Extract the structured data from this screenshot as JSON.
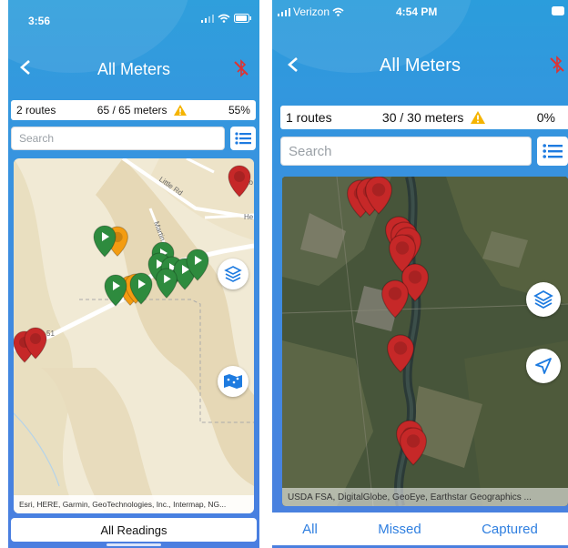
{
  "left": {
    "status": {
      "time": "3:56"
    },
    "nav": {
      "title": "All Meters"
    },
    "summary": {
      "routes": "2 routes",
      "meters": "65 / 65 meters",
      "percent": "55%"
    },
    "search": {
      "placeholder": "Search"
    },
    "map": {
      "road_labels": [
        "Little Rd",
        "Martin St",
        "Lo",
        "He",
        "51"
      ],
      "attribution": "Esri, HERE, Garmin, GeoTechnologies, Inc., Intermap, NG..."
    },
    "footer": {
      "label": "All Readings"
    }
  },
  "right": {
    "status": {
      "carrier": "Verizon",
      "time": "4:54 PM"
    },
    "nav": {
      "title": "All Meters"
    },
    "summary": {
      "routes": "1 routes",
      "meters": "30 / 30 meters",
      "percent": "0%"
    },
    "search": {
      "placeholder": "Search"
    },
    "map": {
      "attribution": "USDA FSA, DigitalGlobe, GeoEye, Earthstar Geographics ..."
    },
    "tabs": [
      "All",
      "Missed",
      "Captured"
    ]
  },
  "colors": {
    "header_blue": "#3a8fe0",
    "marker_red": "#c62828",
    "marker_green": "#2e8b3e",
    "marker_orange": "#f39c12",
    "tab_blue": "#2f7fe0",
    "warning": "#f5b400"
  },
  "icons": {
    "back": "chevron-left-icon",
    "bluetooth": "bluetooth-disabled-icon",
    "warning": "warning-icon",
    "list": "list-icon",
    "layers": "layers-icon",
    "map_legend": "map-icon",
    "location": "navigation-arrow-icon"
  }
}
